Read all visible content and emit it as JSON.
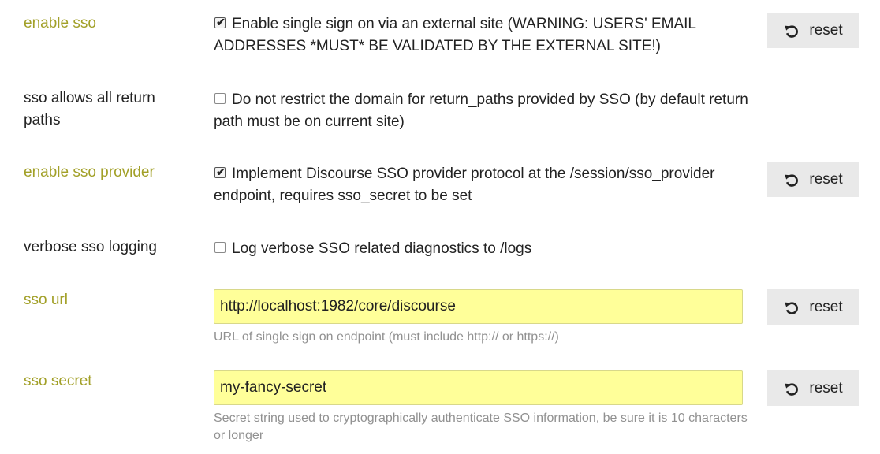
{
  "settings": [
    {
      "label": "enable sso",
      "description": "Enable single sign on via an external site (WARNING: USERS' EMAIL ADDRESSES *MUST* BE VALIDATED BY THE EXTERNAL SITE!)",
      "checked": true,
      "reset_label": "reset"
    },
    {
      "label": "sso allows all return paths",
      "description": "Do not restrict the domain for return_paths provided by SSO (by default return path must be on current site)",
      "checked": false
    },
    {
      "label": "enable sso provider",
      "description": "Implement Discourse SSO provider protocol at the /session/sso_provider endpoint, requires sso_secret to be set",
      "checked": true,
      "reset_label": "reset"
    },
    {
      "label": "verbose sso logging",
      "description": "Log verbose SSO related diagnostics to /logs",
      "checked": false
    },
    {
      "label": "sso url",
      "value": "http://localhost:1982/core/discourse",
      "help": "URL of single sign on endpoint (must include http:// or https://)",
      "reset_label": "reset"
    },
    {
      "label": "sso secret",
      "value": "my-fancy-secret",
      "help": "Secret string used to cryptographically authenticate SSO information, be sure it is 10 characters or longer",
      "reset_label": "reset"
    }
  ],
  "colors": {
    "modified_label": "#a2a028",
    "input_background": "#ffff99",
    "button_background": "#e9e9e9"
  },
  "icons": {
    "reset": "undo-icon",
    "checked": "checkbox-checked",
    "unchecked": "checkbox-unchecked"
  }
}
